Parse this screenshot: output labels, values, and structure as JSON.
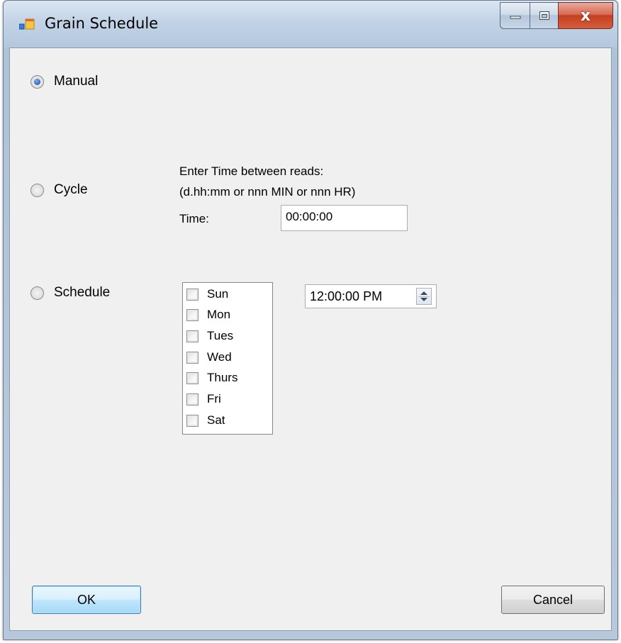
{
  "window": {
    "title": "Grain Schedule",
    "minimize_label": "minimize",
    "maximize_label": "maximize",
    "close_label": "x"
  },
  "modes": {
    "selected": "Manual",
    "manual_label": "Manual",
    "cycle_label": "Cycle",
    "schedule_label": "Schedule"
  },
  "cycle": {
    "instructions_line1": "Enter Time between reads:",
    "instructions_line2": "(d.hh:mm or nnn MIN or nnn HR)",
    "time_label": "Time:",
    "time_value": "00:00:00"
  },
  "schedule": {
    "days": [
      "Sun",
      "Mon",
      "Tues",
      "Wed",
      "Thurs",
      "Fri",
      "Sat"
    ],
    "time_value": "12:00:00 PM"
  },
  "buttons": {
    "ok_label": "OK",
    "cancel_label": "Cancel"
  },
  "colors": {
    "client_bg": "#f0f0f0",
    "close_button": "#c2401f",
    "radio_selected": "#2a62c2"
  }
}
